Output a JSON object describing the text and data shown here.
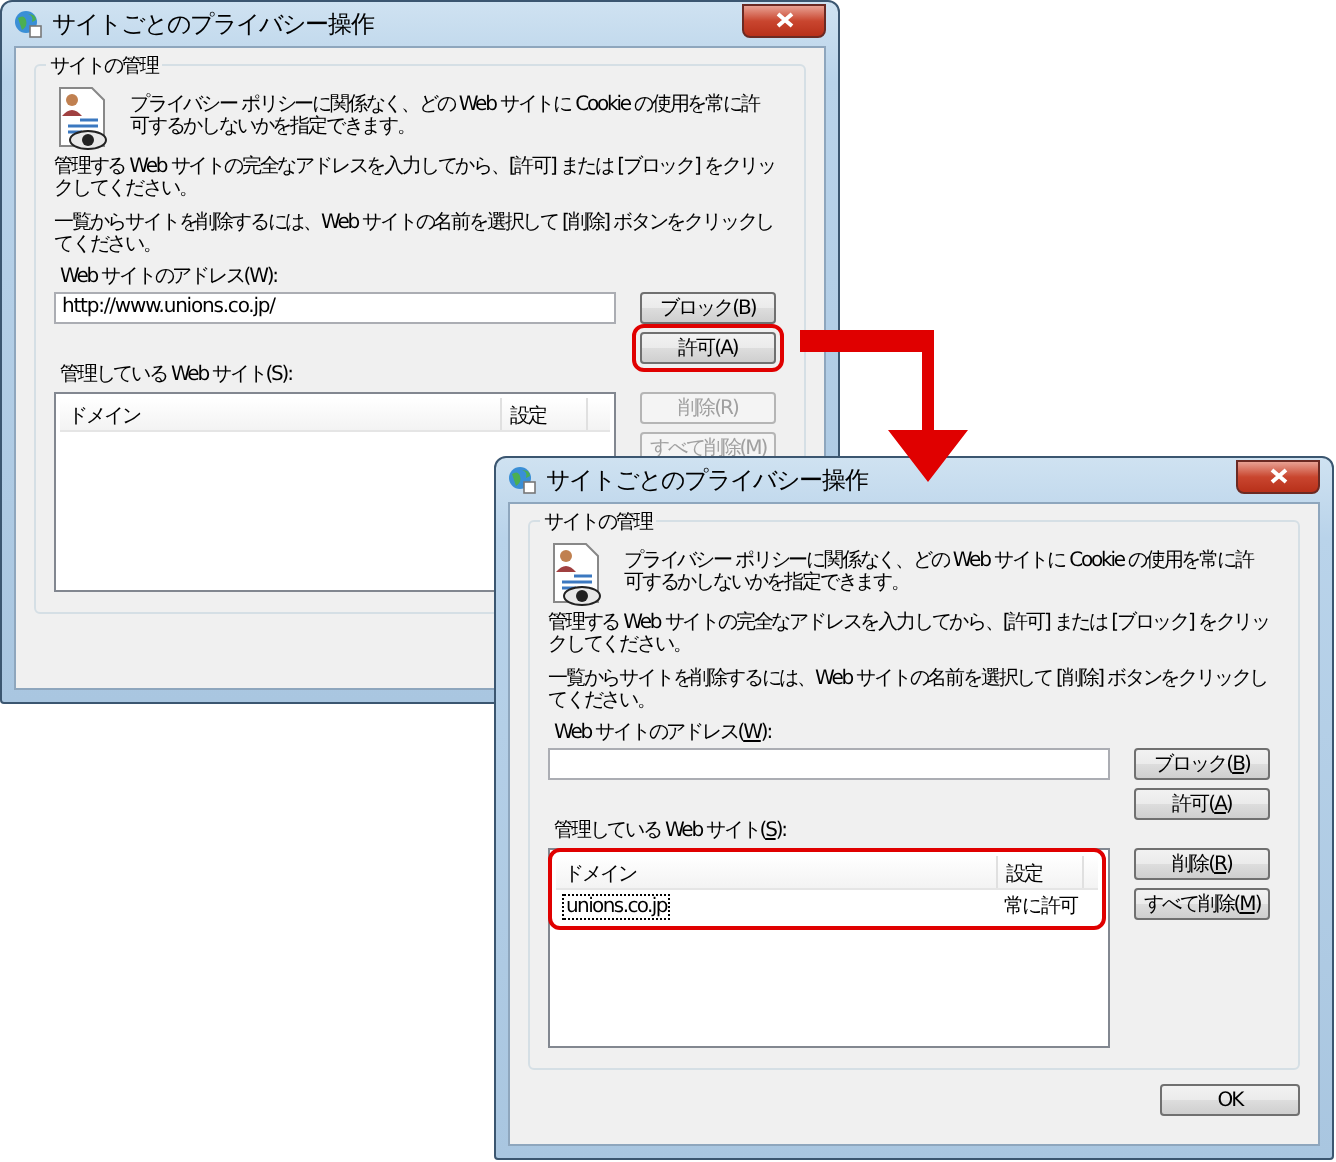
{
  "windows": [
    {
      "title": "サイトごとのプライバシー操作",
      "access_keys_underlined": false,
      "group_title": "サイトの管理",
      "intro": "プライバシー ポリシーに関係なく、どの Web サイトに Cookie の使用を常に許可するかしないかを指定できます。",
      "instructions": [
        "管理する Web サイトの完全なアドレスを入力してから、[許可] または [ブロック] をクリックしてください。",
        "一覧からサイトを削除するには、Web サイトの名前を選択して [削除] ボタンをクリックしてください。"
      ],
      "address_label": "Web サイトのアドレス(W):",
      "address_value": "http://www.unions.co.jp/",
      "buttons_top": [
        {
          "label": "ブロック(B)",
          "disabled": false,
          "highlighted": false
        },
        {
          "label": "許可(A)",
          "disabled": false,
          "highlighted": true
        }
      ],
      "list_label": "管理している Web サイト(S):",
      "columns": [
        "ドメイン",
        "設定"
      ],
      "list_highlighted": false,
      "buttons_side": [
        {
          "label": "削除(R)",
          "disabled": true
        },
        {
          "label": "すべて削除(M)",
          "disabled": true
        }
      ]
    },
    {
      "title": "サイトごとのプライバシー操作",
      "access_keys_underlined": true,
      "group_title": "サイトの管理",
      "intro": "プライバシー ポリシーに関係なく、どの Web サイトに Cookie の使用を常に許可するかしないかを指定できます。",
      "instructions": [
        "管理する Web サイトの完全なアドレスを入力してから、[許可] または [ブロック] をクリックしてください。",
        "一覧からサイトを削除するには、Web サイトの名前を選択して [削除] ボタンをクリックしてください。"
      ],
      "address_label": "Web サイトのアドレス(W):",
      "buttons_top": [
        {
          "label": "ブロック(B)",
          "disabled": false,
          "highlighted": false
        },
        {
          "label": "許可(A)",
          "disabled": false,
          "highlighted": false
        }
      ],
      "list_label": "管理している Web サイト(S):",
      "columns": [
        "ドメイン",
        "設定"
      ],
      "rows": [
        {
          "domain": "unions.co.jp",
          "setting": "常に許可",
          "focused": true
        }
      ],
      "list_highlighted": true,
      "buttons_side": [
        {
          "label": "削除(R)",
          "disabled": false
        },
        {
          "label": "すべて削除(M)",
          "disabled": false
        }
      ],
      "ok_button": "OK"
    }
  ]
}
